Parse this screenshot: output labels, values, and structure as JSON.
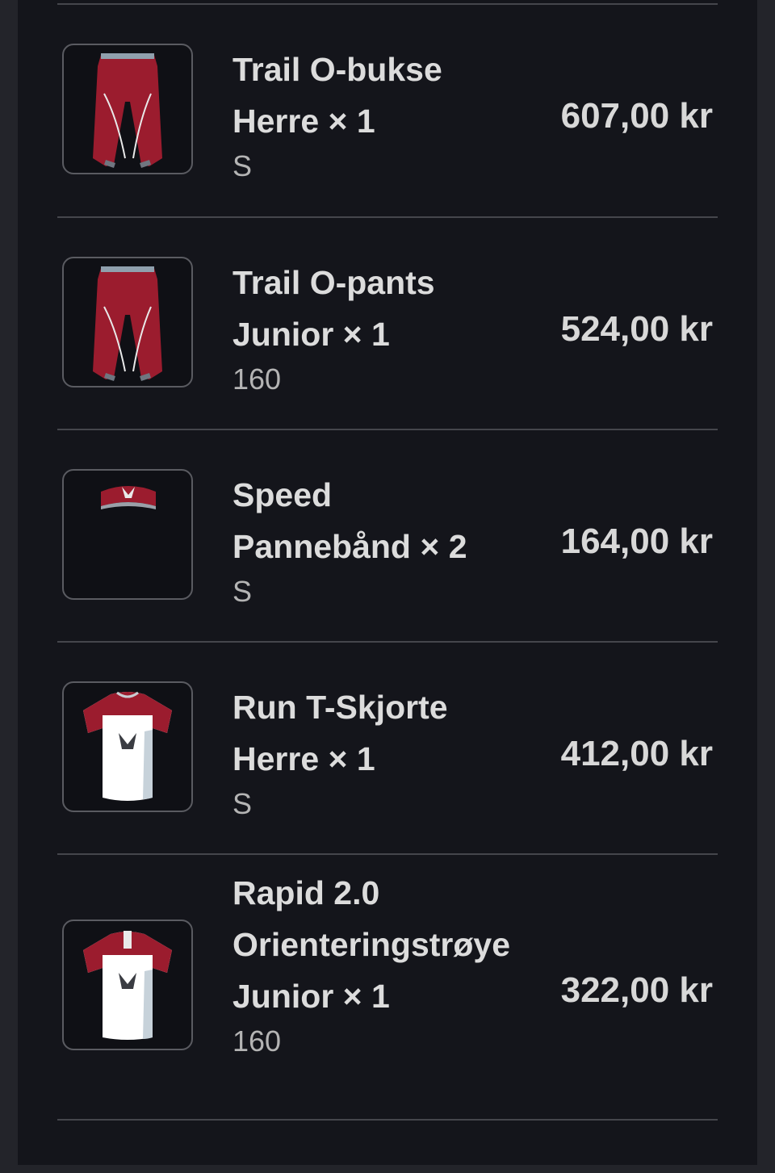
{
  "cart": {
    "items": [
      {
        "name_lines": [
          "Trail O-bukse",
          "Herre × 1"
        ],
        "variant": "S",
        "price": "607,00 kr",
        "image_icon": "pants-icon"
      },
      {
        "name_lines": [
          "Trail O-pants",
          "Junior × 1"
        ],
        "variant": "160",
        "price": "524,00 kr",
        "image_icon": "pants-icon"
      },
      {
        "name_lines": [
          "Speed",
          "Pannebånd × 2"
        ],
        "variant": "S",
        "price": "164,00 kr",
        "image_icon": "headband-icon"
      },
      {
        "name_lines": [
          "Run T-Skjorte",
          "Herre × 1"
        ],
        "variant": "S",
        "price": "412,00 kr",
        "image_icon": "tshirt-icon"
      },
      {
        "name_lines": [
          "Rapid 2.0",
          "Orienteringstrøye",
          "Junior × 1"
        ],
        "variant": "160",
        "price": "322,00 kr",
        "image_icon": "jersey-icon"
      }
    ]
  },
  "colors": {
    "background": "#14151b",
    "product_red": "#9b1c2e",
    "text": "#dcdcdc"
  }
}
